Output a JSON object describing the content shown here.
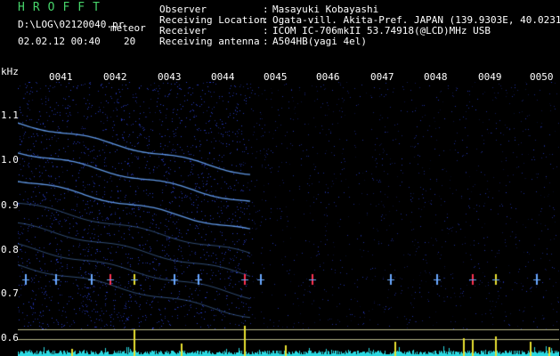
{
  "header": {
    "app_title": "HROFFT",
    "file_path": "D:\\LOG\\02120040.pr",
    "meteor_label": "meteor",
    "timestamp": "02.02.12 00:40",
    "count": "20"
  },
  "info": [
    {
      "label": "Observer",
      "value": "Masayuki Kobayashi"
    },
    {
      "label": "Receiving Location",
      "value": "Ogata-vill. Akita-Pref. JAPAN (139.9303E, 40.0231N)"
    },
    {
      "label": "Receiver",
      "value": "ICOM IC-706mkII 53.74918(@LCD)MHz USB"
    },
    {
      "label": "Receiving antenna",
      "value": "A504HB(yagi 4el)"
    }
  ],
  "axis": {
    "unit": "kHz",
    "x_ticks": [
      "0041",
      "0042",
      "0043",
      "0044",
      "0045",
      "0046",
      "0047",
      "0048",
      "0049",
      "0050"
    ],
    "y_ticks": [
      "1.1",
      "1.0",
      "0.9",
      "0.8",
      "0.7",
      "0.6"
    ]
  },
  "colors": {
    "background": "#000000",
    "noise": "#1c2a9c",
    "trace": "#6aa8ff",
    "title": "#46d46a",
    "text": "#ffffff",
    "ref_line": "#b9b98a",
    "cyan_floor": "#2ad8e0",
    "meteor_yellow": "#e8e030",
    "meteor_red": "#ff3050"
  }
}
